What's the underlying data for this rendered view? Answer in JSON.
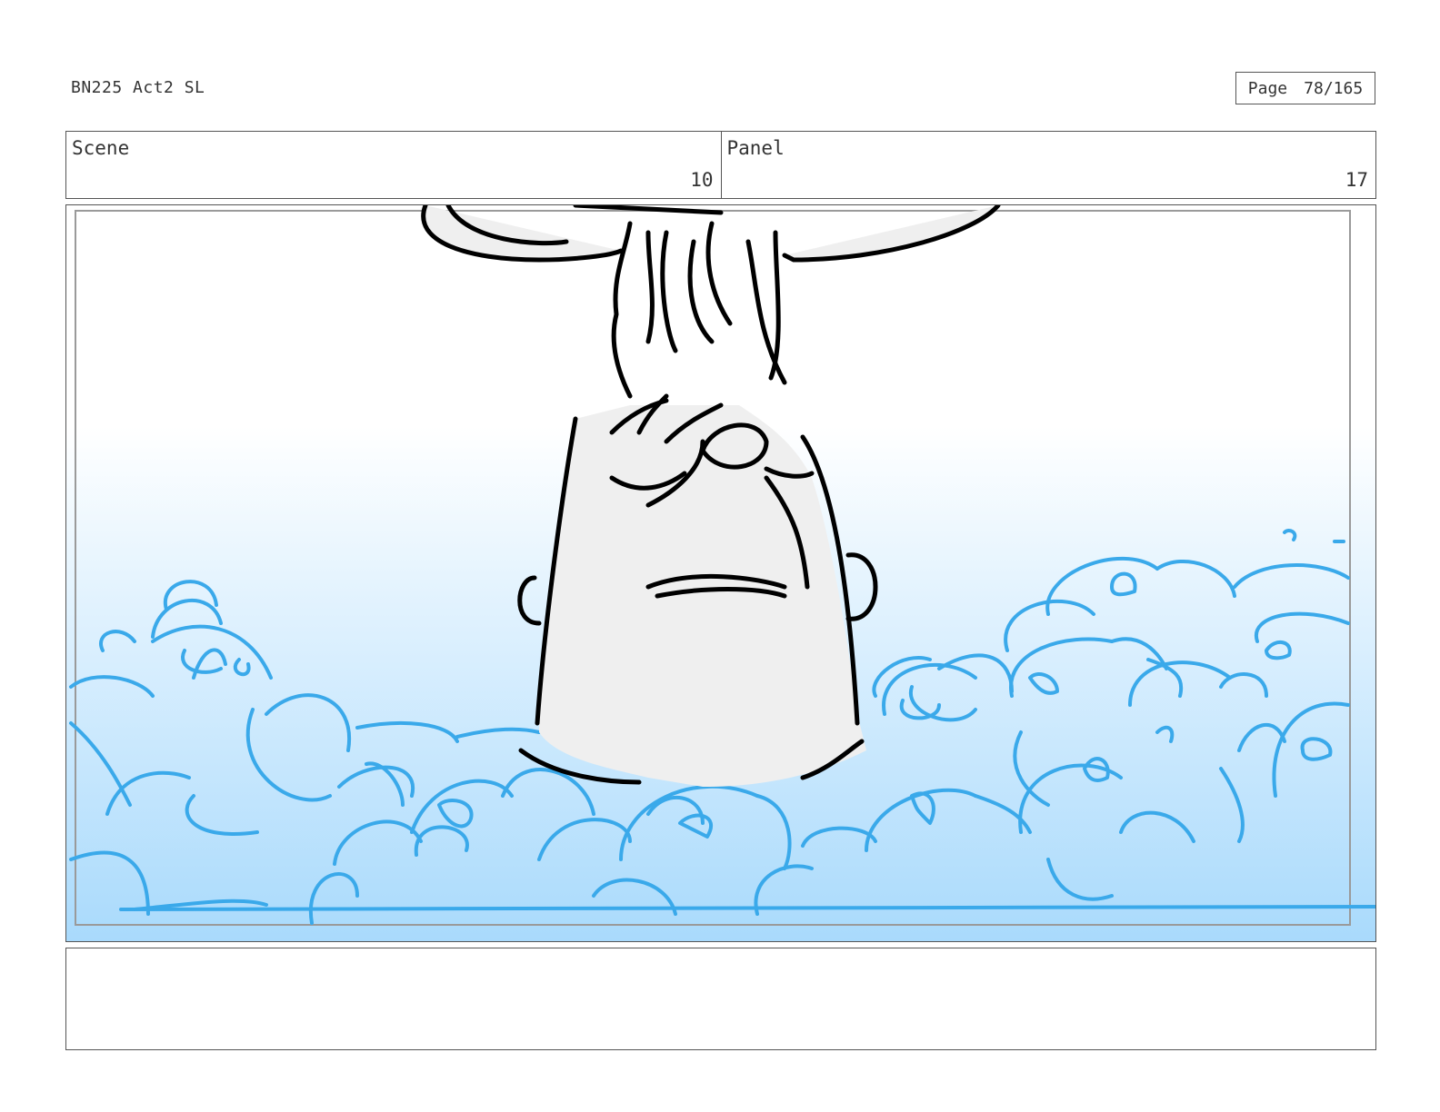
{
  "document": {
    "title": "BN225 Act2 SL",
    "page_label": "Page",
    "page_number": "78/165"
  },
  "header": {
    "scene_label": "Scene",
    "scene_value": "10",
    "panel_label": "Panel",
    "panel_value": "17"
  },
  "panel": {
    "drawing": "storyboard-sketch-icon",
    "colors": {
      "cloud_line": "#3aa9ea",
      "sky_top": "#ffffff",
      "sky_bottom": "#a9dafc",
      "ink": "#000000",
      "skin": "#efefef"
    }
  },
  "notes": {
    "text": ""
  }
}
